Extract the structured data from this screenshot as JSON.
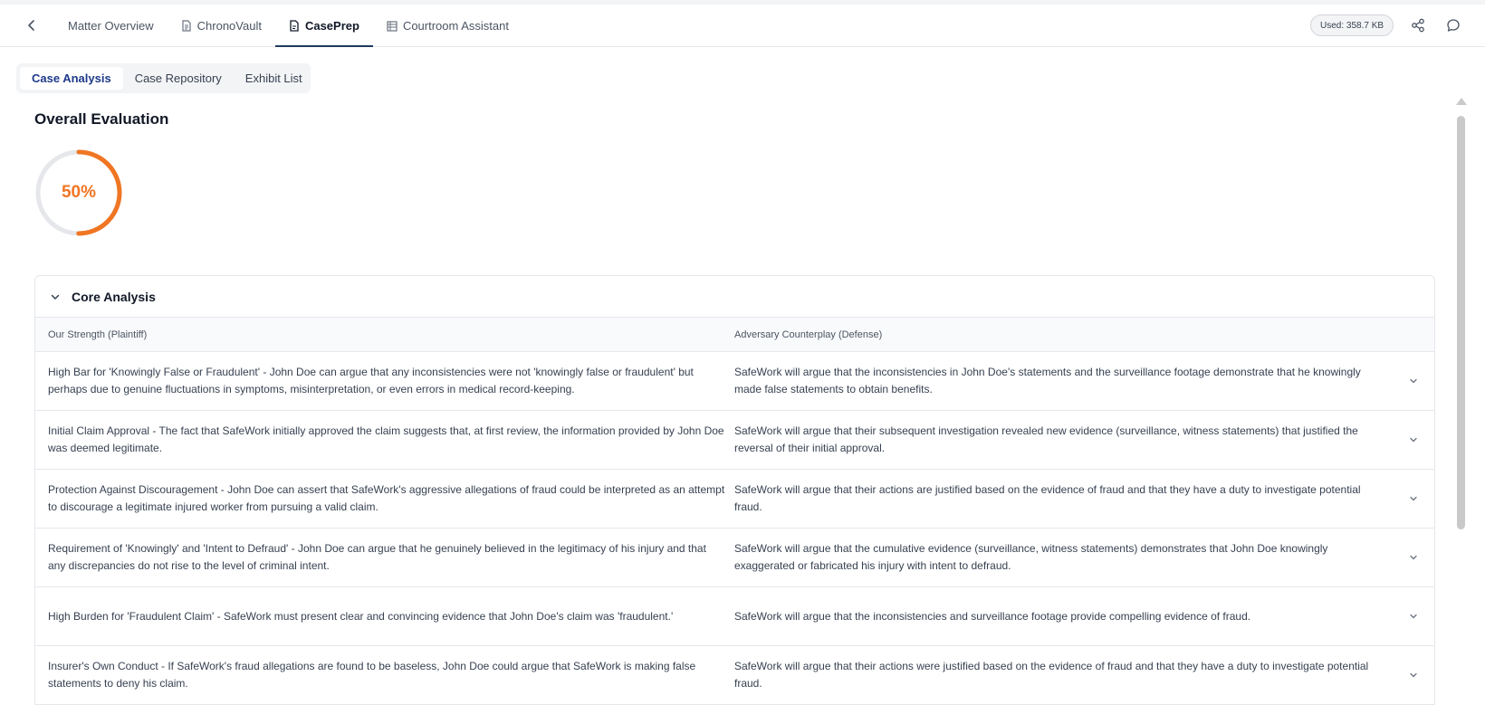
{
  "header": {
    "tabs": [
      {
        "label": "Matter Overview",
        "icon": "none"
      },
      {
        "label": "ChronoVault",
        "icon": "document-icon"
      },
      {
        "label": "CasePrep",
        "icon": "document-icon",
        "active": true
      },
      {
        "label": "Courtroom Assistant",
        "icon": "stack-icon"
      }
    ],
    "used_label": "Used: 358.7 KB"
  },
  "subtabs": [
    {
      "label": "Case Analysis",
      "active": true
    },
    {
      "label": "Case Repository"
    },
    {
      "label": "Exhibit List"
    }
  ],
  "evaluation": {
    "title": "Overall Evaluation",
    "percent_label": "50%",
    "percent_value": 0.5,
    "accent_color": "#f07623"
  },
  "core_analysis": {
    "title": "Core Analysis",
    "columns": [
      "Our Strength (Plaintiff)",
      "Adversary Counterplay (Defense)"
    ],
    "rows": [
      {
        "strength": "High Bar for 'Knowingly False or Fraudulent' - John Doe can argue that any inconsistencies were not 'knowingly false or fraudulent' but perhaps due to genuine fluctuations in symptoms, misinterpretation, or even errors in medical record-keeping.",
        "counter": "SafeWork will argue that the inconsistencies in John Doe's statements and the surveillance footage demonstrate that he knowingly made false statements to obtain benefits."
      },
      {
        "strength": "Initial Claim Approval - The fact that SafeWork initially approved the claim suggests that, at first review, the information provided by John Doe was deemed legitimate.",
        "counter": "SafeWork will argue that their subsequent investigation revealed new evidence (surveillance, witness statements) that justified the reversal of their initial approval."
      },
      {
        "strength": "Protection Against Discouragement - John Doe can assert that SafeWork's aggressive allegations of fraud could be interpreted as an attempt to discourage a legitimate injured worker from pursuing a valid claim.",
        "counter": "SafeWork will argue that their actions are justified based on the evidence of fraud and that they have a duty to investigate potential fraud."
      },
      {
        "strength": "Requirement of 'Knowingly' and 'Intent to Defraud' - John Doe can argue that he genuinely believed in the legitimacy of his injury and that any discrepancies do not rise to the level of criminal intent.",
        "counter": "SafeWork will argue that the cumulative evidence (surveillance, witness statements) demonstrates that John Doe knowingly exaggerated or fabricated his injury with intent to defraud."
      },
      {
        "strength": "High Burden for 'Fraudulent Claim' - SafeWork must present clear and convincing evidence that John Doe's claim was 'fraudulent.'",
        "counter": "SafeWork will argue that the inconsistencies and surveillance footage provide compelling evidence of fraud."
      },
      {
        "strength": "Insurer's Own Conduct - If SafeWork's fraud allegations are found to be baseless, John Doe could argue that SafeWork is making false statements to deny his claim.",
        "counter": "SafeWork will argue that their actions were justified based on the evidence of fraud and that they have a duty to investigate potential fraud."
      }
    ]
  }
}
